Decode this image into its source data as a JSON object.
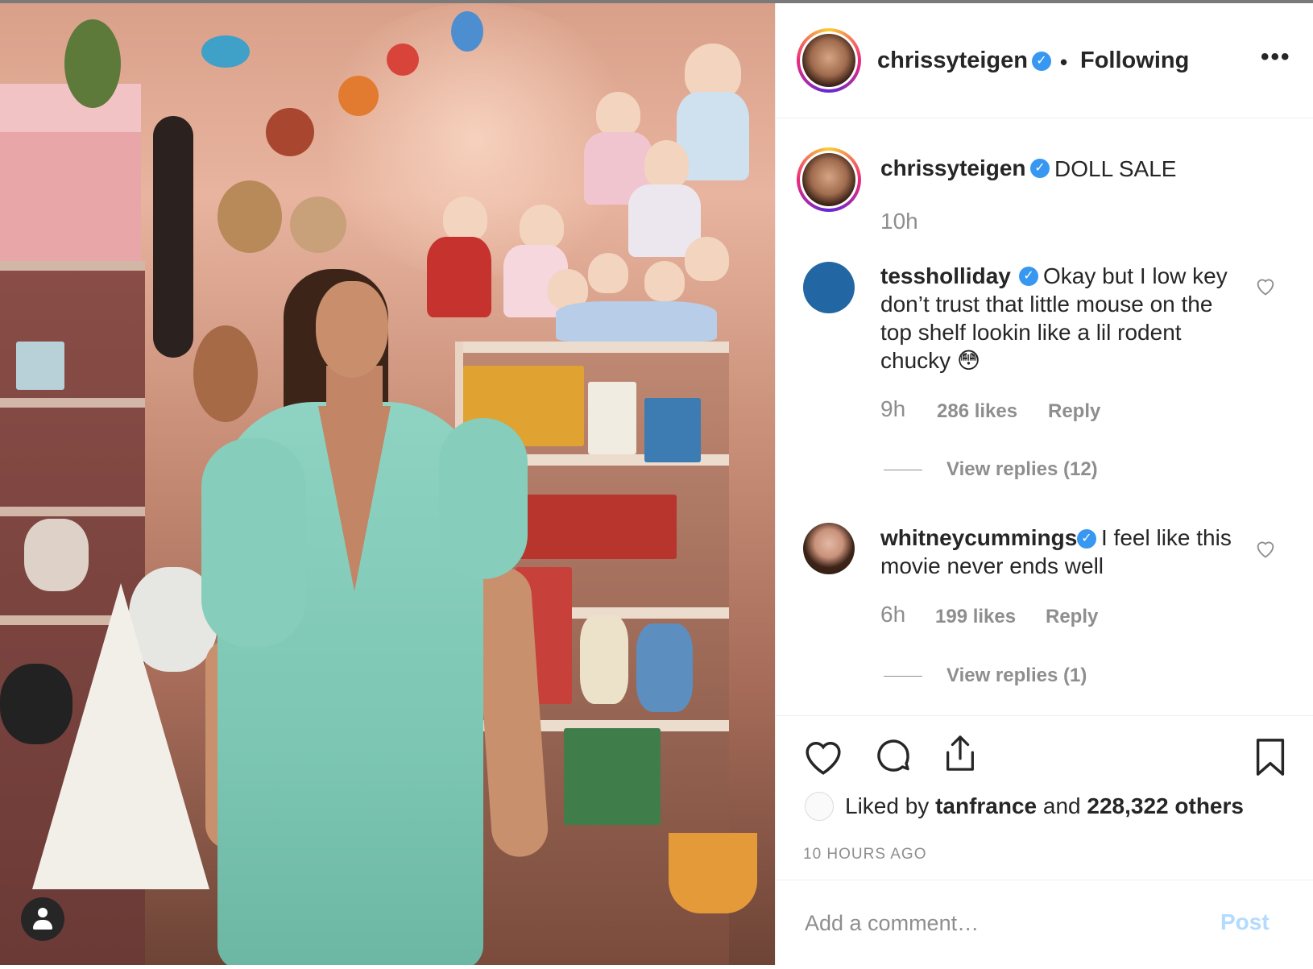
{
  "post": {
    "author": "chrissyteigen",
    "follow_separator": "•",
    "follow_status": "Following",
    "more_label": "•••"
  },
  "caption": {
    "author": "chrissyteigen",
    "text": "DOLL SALE",
    "time": "10h"
  },
  "comments": [
    {
      "author": "tessholliday",
      "text": "Okay but I low key",
      "lines": [
        "don’t trust that little mouse on the",
        "top shelf lookin like a lil rodent",
        "chucky 😳"
      ],
      "time": "9h",
      "likes": "286 likes",
      "reply_label": "Reply",
      "view_replies": "View replies (12)"
    },
    {
      "author": "whitneycummings",
      "text": "I feel like this",
      "lines": [
        "movie never ends well"
      ],
      "time": "6h",
      "likes": "199 likes",
      "reply_label": "Reply",
      "view_replies": "View replies (1)"
    }
  ],
  "likes_summary": {
    "prefix": "Liked by",
    "user": "tanfrance",
    "middle": "and",
    "others": "228,322 others"
  },
  "posted_ago": "10 HOURS AGO",
  "comment_box": {
    "placeholder": "Add a comment…",
    "post_label": "Post"
  },
  "icons": {
    "verified": "verified-badge-icon",
    "like": "heart-icon",
    "comment": "speech-bubble-icon",
    "share": "share-icon",
    "save": "bookmark-icon",
    "tag": "user-tag-icon"
  },
  "colors": {
    "verified": "#3897f0",
    "muted": "#8e8e8e",
    "post_button": "#b3dbff",
    "text": "#262626"
  }
}
